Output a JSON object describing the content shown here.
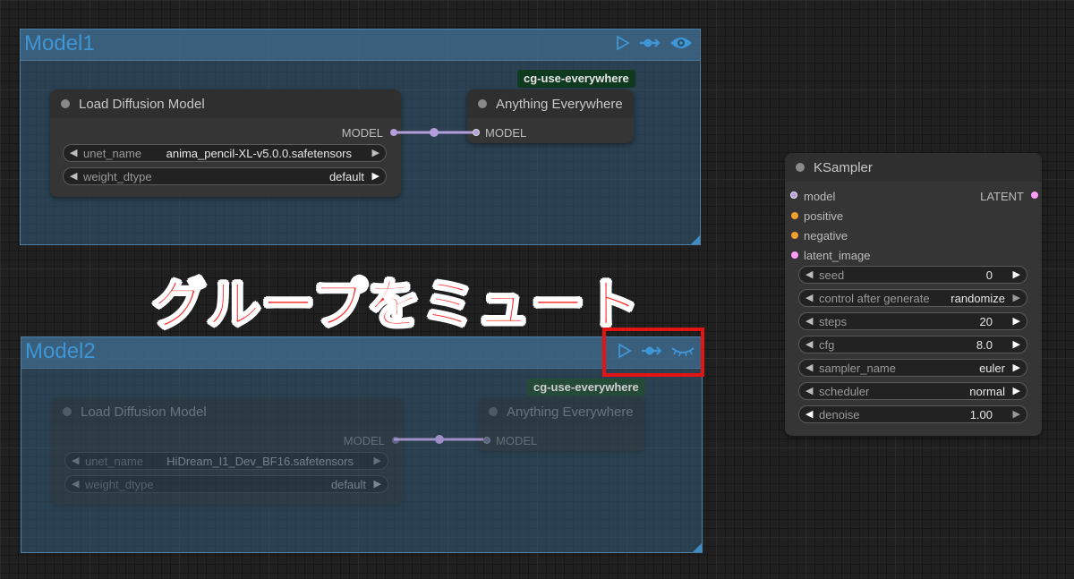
{
  "groups": [
    {
      "title": "Model1",
      "muted": false,
      "load_node": {
        "title": "Load Diffusion Model",
        "output_label": "MODEL",
        "widgets": [
          {
            "label": "unet_name",
            "value": "anima_pencil-XL-v5.0.0.safetensors"
          },
          {
            "label": "weight_dtype",
            "value": "default"
          }
        ]
      },
      "ae_node": {
        "title": "Anything Everywhere",
        "input_label": "MODEL"
      },
      "tag": "cg-use-everywhere"
    },
    {
      "title": "Model2",
      "muted": true,
      "load_node": {
        "title": "Load Diffusion Model",
        "output_label": "MODEL",
        "widgets": [
          {
            "label": "unet_name",
            "value": "HiDream_I1_Dev_BF16.safetensors"
          },
          {
            "label": "weight_dtype",
            "value": "default"
          }
        ]
      },
      "ae_node": {
        "title": "Anything Everywhere",
        "input_label": "MODEL"
      },
      "tag": "cg-use-everywhere"
    }
  ],
  "group_icons": [
    "play-icon",
    "bypass-icon",
    "eye-icon",
    "eye-closed-icon"
  ],
  "annotation": "グループをミュート",
  "ksampler": {
    "title": "KSampler",
    "inputs": [
      "model",
      "positive",
      "negative",
      "latent_image"
    ],
    "output": "LATENT",
    "widgets": [
      {
        "label": "seed",
        "value": "0"
      },
      {
        "label": "control after generate",
        "value": "randomize"
      },
      {
        "label": "steps",
        "value": "20"
      },
      {
        "label": "cfg",
        "value": "8.0"
      },
      {
        "label": "sampler_name",
        "value": "euler"
      },
      {
        "label": "scheduler",
        "value": "normal"
      },
      {
        "label": "denoise",
        "value": "1.00"
      }
    ]
  },
  "colors": {
    "model_link": "#b39ddb",
    "positive": "#f0a030",
    "negative": "#f0a030",
    "latent": "#ff9cf9",
    "group_title": "#3f96d6",
    "annotation": "#ff2a2a"
  }
}
